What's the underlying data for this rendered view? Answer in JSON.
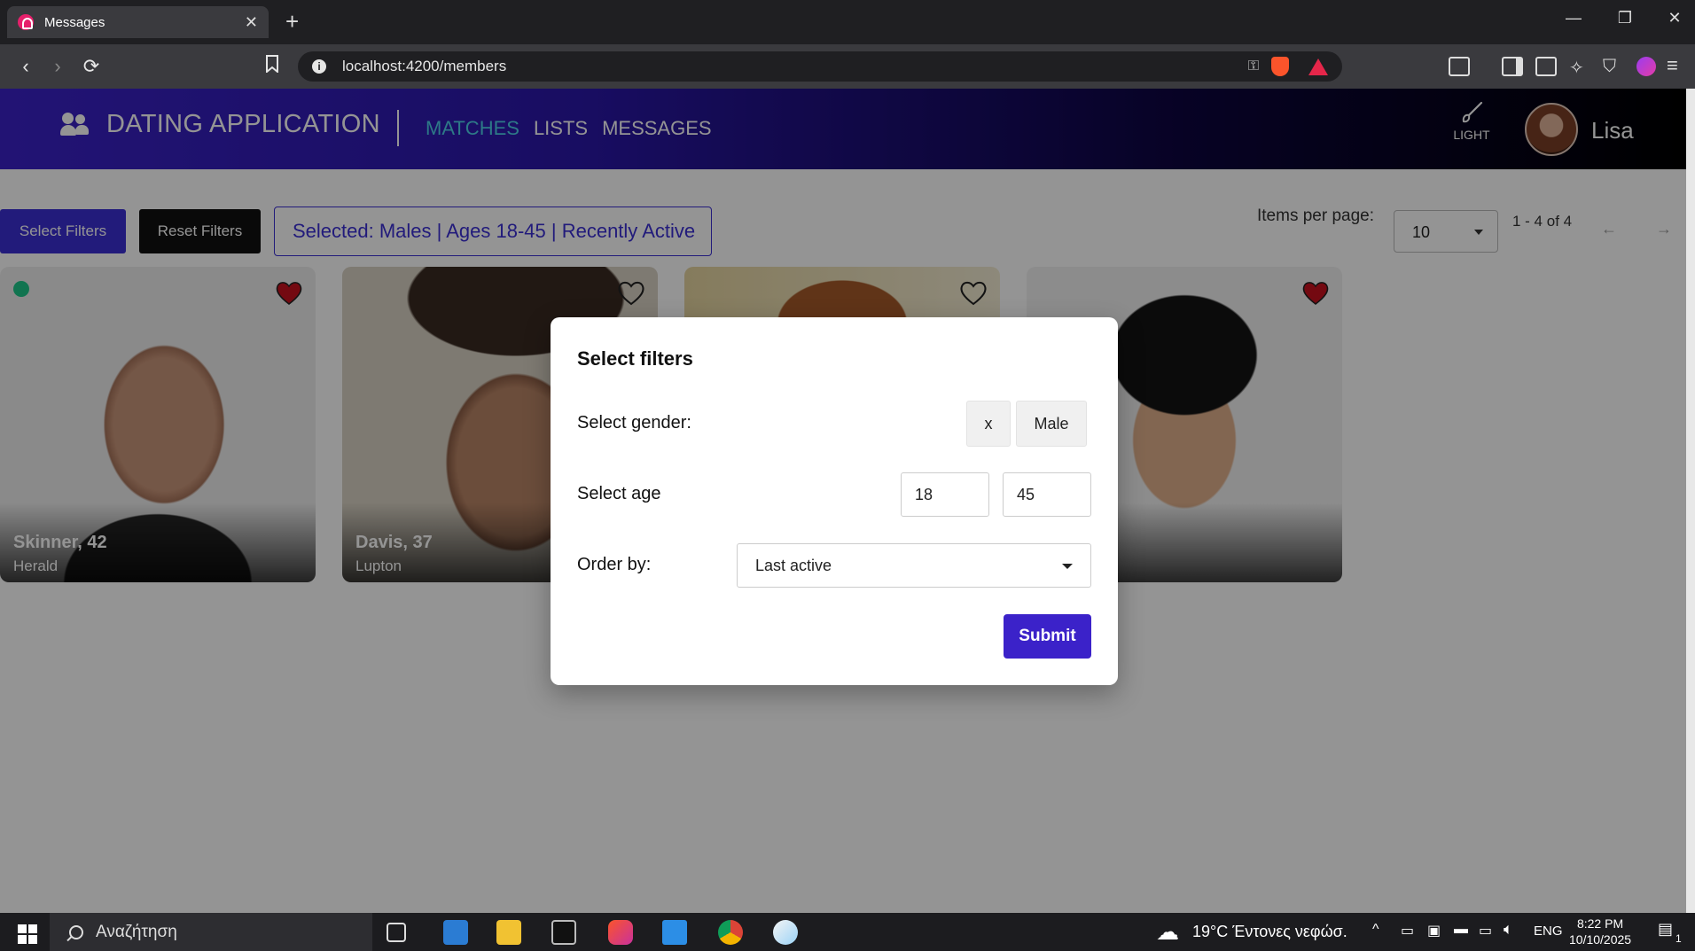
{
  "browser": {
    "tab_title": "Messages",
    "tab_close": "✕",
    "new_tab": "+",
    "url": "localhost:4200/members",
    "window_controls": [
      "—",
      "❐",
      "✕"
    ]
  },
  "navbar": {
    "brand": "DATING APPLICATION",
    "links": [
      "MATCHES",
      "LISTS",
      "MESSAGES"
    ],
    "active_link": "MATCHES",
    "theme_label": "LIGHT",
    "username": "Lisa"
  },
  "filters": {
    "select_button": "Select Filters",
    "reset_button": "Reset Filters",
    "selected_summary": "Selected: Males | Ages 18-45 | Recently Active"
  },
  "pagination": {
    "items_per_page_label": "Items per page:",
    "items_per_page_value": "10",
    "range": "1 - 4 of 4",
    "prev": "←",
    "next": "→"
  },
  "members": [
    {
      "name": "Skinner, 42",
      "city": "Herald",
      "liked": true,
      "online": true
    },
    {
      "name": "Davis, 37",
      "city": "Lupton",
      "liked": false,
      "online": false
    },
    {
      "name": "",
      "city": "",
      "liked": false,
      "online": false
    },
    {
      "name": "",
      "city": "",
      "liked": true,
      "online": false
    }
  ],
  "modal": {
    "title": "Select filters",
    "gender_label": "Select gender:",
    "gender_clear": "x",
    "gender_value": "Male",
    "age_label": "Select age",
    "age_min": "18",
    "age_max": "45",
    "order_label": "Order by:",
    "order_value": "Last active",
    "submit": "Submit"
  },
  "taskbar": {
    "search_placeholder": "Αναζήτηση",
    "weather": "19°C  Έντονες νεφώσ.",
    "language": "ENG",
    "time": "8:22 PM",
    "date": "10/10/2025",
    "notifications": "1"
  },
  "colors": {
    "brand_primary": "#3b22c9",
    "active_link": "#4fd1e8",
    "heart_red": "#c8101e",
    "online_green": "#1ec98a"
  }
}
